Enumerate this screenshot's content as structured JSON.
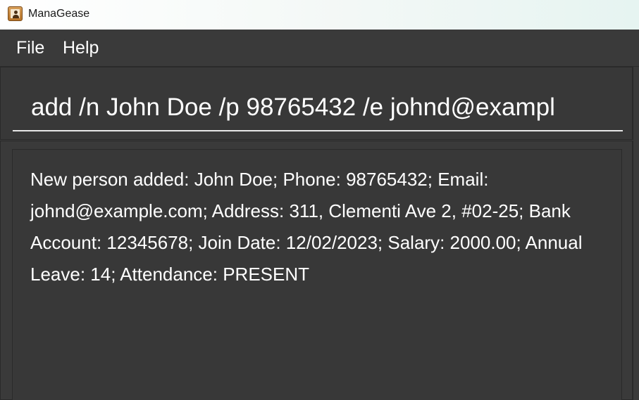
{
  "window": {
    "title": "ManaGease",
    "icon": "address-book-icon"
  },
  "menubar": {
    "items": [
      {
        "label": "File"
      },
      {
        "label": "Help"
      }
    ]
  },
  "command": {
    "value": "add /n John Doe /p 98765432 /e johnd@exampl"
  },
  "result": {
    "lines": [
      "New person added: John Doe; Phone: 98765432; Email:",
      "johnd@example.com; Address: 311, Clementi Ave 2, #02-25; Bank",
      "Account: 12345678; Join Date: 12/02/2023; Salary: 2000.00;",
      "Annual Leave: 14; Attendance: PRESENT"
    ]
  },
  "colors": {
    "background": "#3a3a3a",
    "panel": "#383838",
    "text": "#ffffff",
    "input_underline": "#e6e6e6"
  }
}
